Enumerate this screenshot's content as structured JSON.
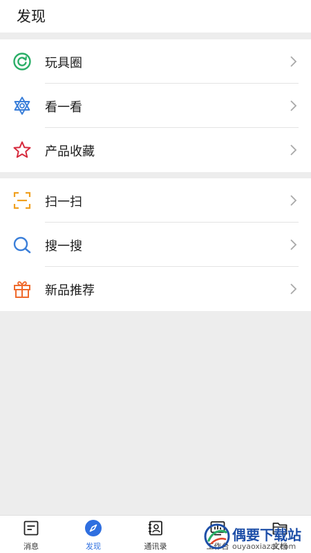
{
  "header": {
    "title": "发现"
  },
  "menu_groups": [
    {
      "items": [
        {
          "label": "玩具圈",
          "icon": "refresh-circle-icon",
          "color": "#2aae67"
        },
        {
          "label": "看一看",
          "icon": "star-of-david-icon",
          "color": "#3b7fd9"
        },
        {
          "label": "产品收藏",
          "icon": "star-icon",
          "color": "#d6293c"
        }
      ]
    },
    {
      "items": [
        {
          "label": "扫一扫",
          "icon": "scan-icon",
          "color": "#f0a020"
        },
        {
          "label": "搜一搜",
          "icon": "search-icon",
          "color": "#3b7fd9"
        },
        {
          "label": "新品推荐",
          "icon": "gift-icon",
          "color": "#ef6a2c"
        }
      ]
    }
  ],
  "tabbar": {
    "tabs": [
      {
        "label": "消息",
        "icon": "message-icon"
      },
      {
        "label": "发现",
        "icon": "compass-icon",
        "active": true
      },
      {
        "label": "通讯录",
        "icon": "contacts-icon"
      },
      {
        "label": "工作台",
        "icon": "workbench-icon"
      },
      {
        "label": "文档",
        "icon": "folder-icon"
      }
    ],
    "accent_color": "#2f6fe0"
  },
  "watermark": {
    "title": "偶要下载站",
    "url": "ouyaoxiazai.com"
  }
}
